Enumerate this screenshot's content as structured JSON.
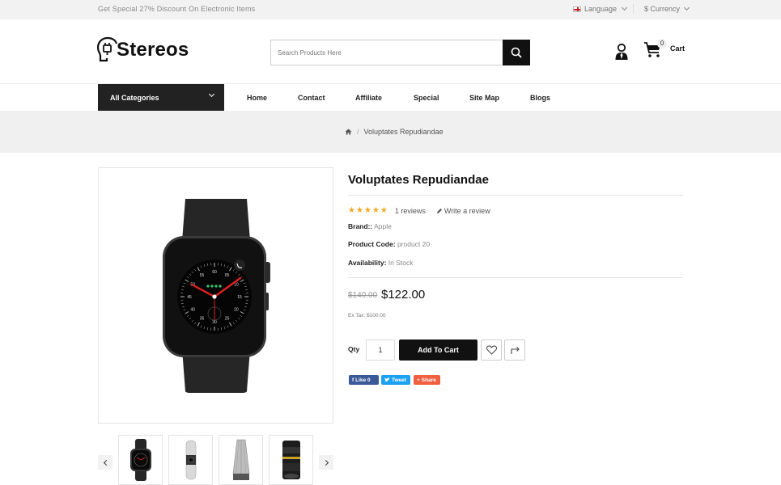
{
  "topbar": {
    "promo": "Get Special 27% Discount On Electronic Items",
    "language_label": "Language",
    "currency_label": "$ Currency"
  },
  "header": {
    "logo_text": "Stereos",
    "search_placeholder": "Search Products Here",
    "cart_label": "Cart",
    "cart_count": "0"
  },
  "nav": {
    "all_categories": "All Categories",
    "items": [
      "Home",
      "Contact",
      "Affiliate",
      "Special",
      "Site Map",
      "Blogs"
    ]
  },
  "breadcrumb": {
    "current": "Voluptates Repudiandae"
  },
  "product": {
    "title": "Voluptates Repudiandae",
    "rating": 5,
    "stars": "★★★★★",
    "reviews": "1 reviews",
    "write_review": "Write a review",
    "brand_label": "Brand::",
    "brand_value": "Apple",
    "code_label": "Product Code:",
    "code_value": "product 20",
    "availability_label": "Availability:",
    "availability_value": "In Stock",
    "old_price": "$140.00",
    "price": "$122.00",
    "ex_tax": "Ex Tax: $100.00",
    "qty_label": "Qty",
    "qty_value": "1",
    "add_to_cart": "Add To Cart"
  },
  "share": {
    "like": "Like 0",
    "tweet": "Tweet",
    "share": "Share"
  },
  "watch_face_numbers": [
    "60",
    "05",
    "10",
    "15",
    "20",
    "25",
    "30",
    "35",
    "40",
    "45",
    "50",
    "55"
  ],
  "colors": {
    "accent": "#111111",
    "topbar_bg": "#f2f2f2",
    "band_bg": "#f0f0f0",
    "star": "#f5a623",
    "facebook": "#3b5998",
    "twitter": "#1da1f2",
    "share": "#f05f40"
  }
}
